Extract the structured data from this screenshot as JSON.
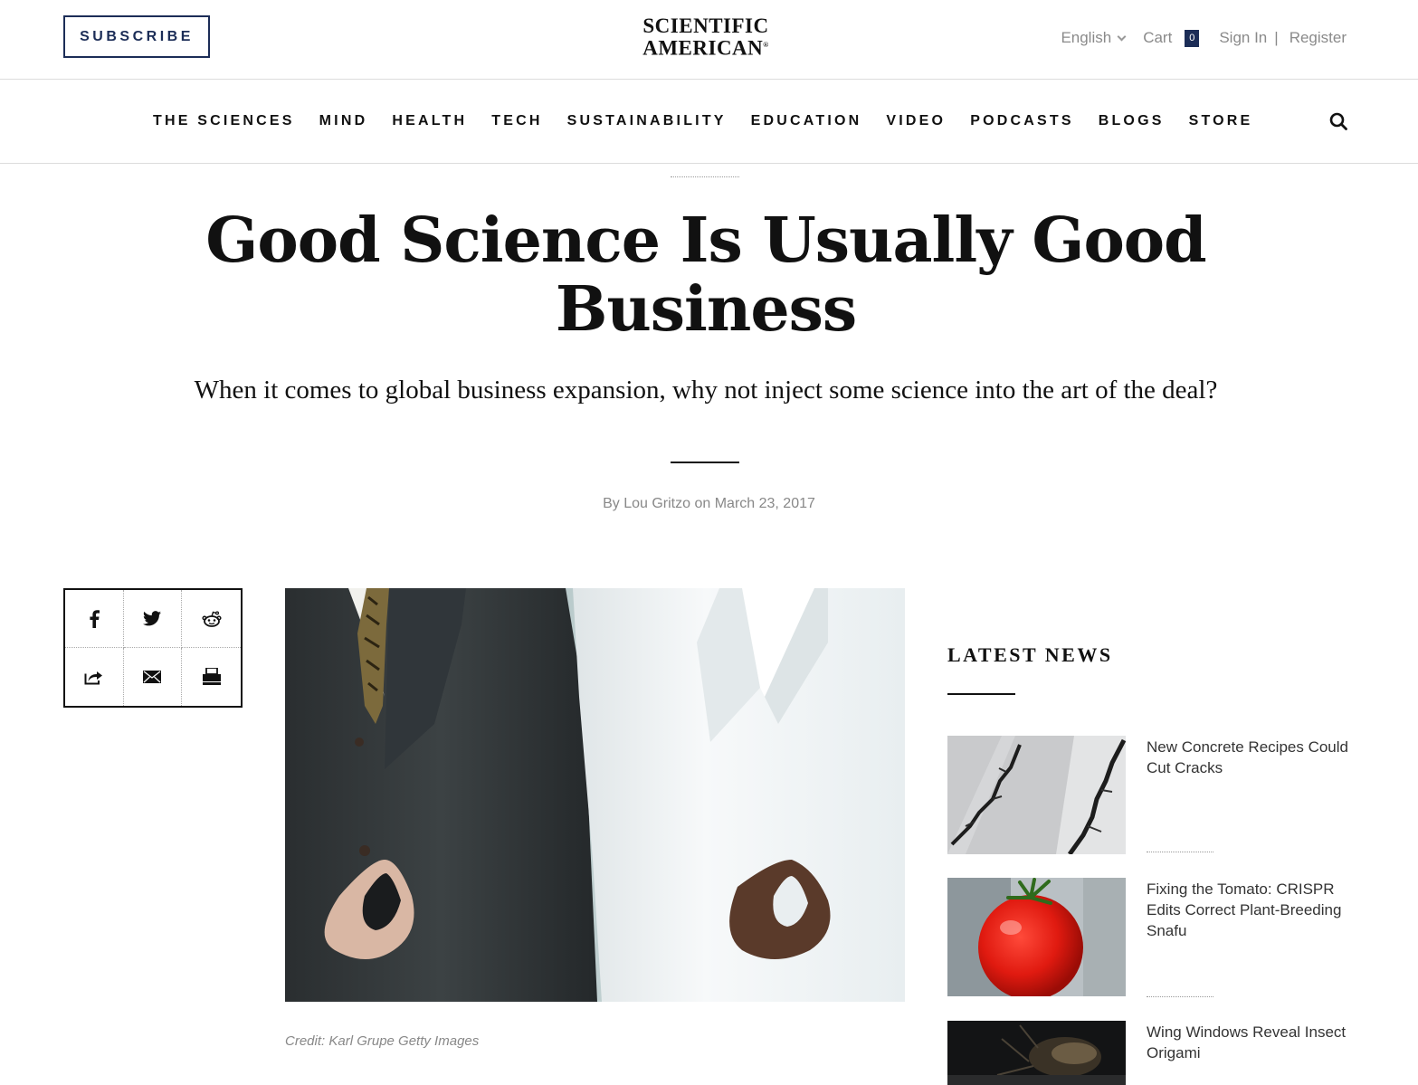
{
  "header": {
    "subscribe_label": "SUBSCRIBE",
    "logo_line1": "SCIENTIFIC",
    "logo_line2": "AMERICAN",
    "logo_mark": "®",
    "language": "English",
    "cart_label": "Cart",
    "cart_count": "0",
    "sign_in": "Sign In",
    "separator": "|",
    "register": "Register"
  },
  "nav": {
    "items": [
      "THE SCIENCES",
      "MIND",
      "HEALTH",
      "TECH",
      "SUSTAINABILITY",
      "EDUCATION",
      "VIDEO",
      "PODCASTS",
      "BLOGS",
      "STORE"
    ]
  },
  "article": {
    "headline": "Good Science Is Usually Good Business",
    "dek": "When it comes to global business expansion, why not inject some science into the art of the deal?",
    "byline": "By Lou Gritzo on March 23, 2017",
    "image_credit": "Credit: Karl Grupe Getty Images"
  },
  "share": {
    "icons": [
      "facebook-icon",
      "twitter-icon",
      "reddit-icon",
      "share-icon",
      "email-icon",
      "print-icon"
    ]
  },
  "latest_news": {
    "title": "LATEST NEWS",
    "items": [
      {
        "title": "New Concrete Recipes Could Cut Cracks"
      },
      {
        "title": "Fixing the Tomato: CRISPR Edits Correct Plant-Breeding Snafu"
      },
      {
        "title": "Wing Windows Reveal Insect Origami"
      }
    ]
  },
  "colors": {
    "brand_navy": "#1c2d57",
    "text_gray": "#888888"
  }
}
